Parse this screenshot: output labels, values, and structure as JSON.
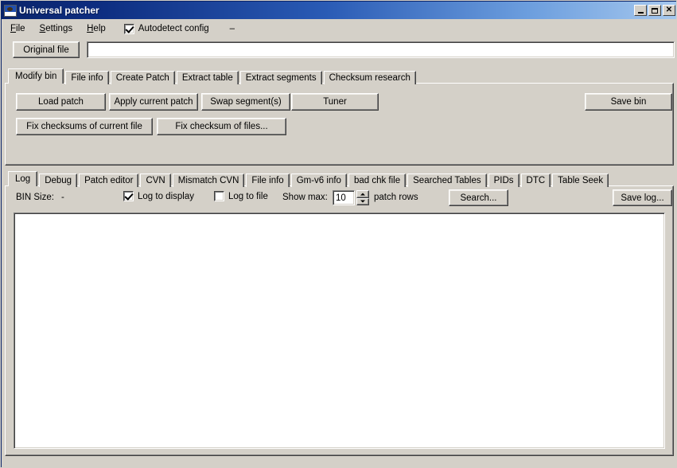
{
  "window": {
    "title": "Universal patcher",
    "icon": "app-icon",
    "controls": {
      "minimize": "_",
      "maximize": "□",
      "close": "✕"
    }
  },
  "menubar": {
    "items": [
      {
        "label": "File",
        "accel": "F"
      },
      {
        "label": "Settings",
        "accel": "S"
      },
      {
        "label": "Help",
        "accel": "H"
      }
    ],
    "autodetect": {
      "label": "Autodetect config",
      "checked": true
    },
    "extra_item": "–"
  },
  "filerow": {
    "original_file_button": "Original file",
    "file_path_value": "",
    "file_path_placeholder": ""
  },
  "upper_tabs": {
    "active_index": 0,
    "items": [
      {
        "label": "Modify bin"
      },
      {
        "label": "File info"
      },
      {
        "label": "Create Patch"
      },
      {
        "label": "Extract table"
      },
      {
        "label": "Extract segments"
      },
      {
        "label": "Checksum research"
      }
    ]
  },
  "modify_bin": {
    "buttons_row1": [
      {
        "label": "Load patch"
      },
      {
        "label": "Apply current patch"
      },
      {
        "label": "Swap segment(s)"
      },
      {
        "label": "Tuner"
      }
    ],
    "save_bin": "Save bin",
    "buttons_row2": [
      {
        "label": "Fix checksums of current file"
      },
      {
        "label": "Fix checksum of files..."
      }
    ]
  },
  "lower_tabs": {
    "active_index": 0,
    "items": [
      {
        "label": "Log"
      },
      {
        "label": "Debug"
      },
      {
        "label": "Patch editor"
      },
      {
        "label": "CVN"
      },
      {
        "label": "Mismatch CVN"
      },
      {
        "label": "File info"
      },
      {
        "label": "Gm-v6 info"
      },
      {
        "label": "bad chk file"
      },
      {
        "label": "Searched Tables"
      },
      {
        "label": "PIDs"
      },
      {
        "label": "DTC"
      },
      {
        "label": "Table Seek"
      }
    ]
  },
  "log_panel": {
    "bin_size_label": "BIN Size:",
    "bin_size_value": "-",
    "log_to_display": {
      "label": "Log to display",
      "checked": true
    },
    "log_to_file": {
      "label": "Log to file",
      "checked": false
    },
    "show_max_label": "Show max:",
    "show_max_value": "10",
    "patch_rows_label": "patch rows",
    "search_button": "Search...",
    "save_log_button": "Save log...",
    "log_content": ""
  }
}
